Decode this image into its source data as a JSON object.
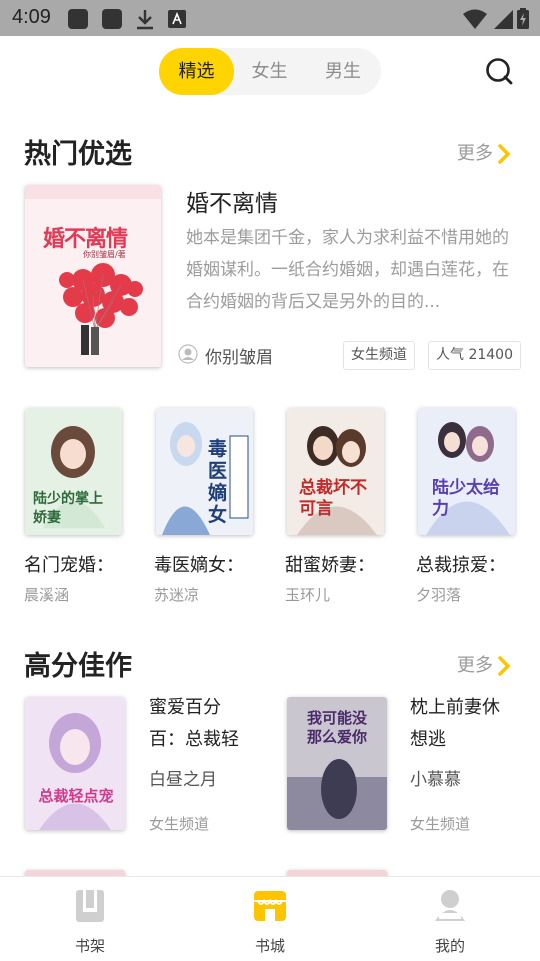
{
  "status_bar": {
    "time": "4:09"
  },
  "tabs": [
    {
      "label": "精选",
      "active": true
    },
    {
      "label": "女生",
      "active": false
    },
    {
      "label": "男生",
      "active": false
    }
  ],
  "hot": {
    "title": "热门优选",
    "more": "更多",
    "featured": {
      "title": "婚不离情",
      "description": "她本是集团千金，家人为求利益不惜用她的婚姻谋利。一纸合约婚姻，却遇白莲花，在合约婚姻的背后又是另外的目的...",
      "author": "你别皱眉",
      "channel": "女生频道",
      "popularity": "人气 21400",
      "cover_text": "婚不离情",
      "cover_sub": "你别皱眉/著"
    },
    "grid": [
      {
        "title": "名门宠婚：",
        "author": "晨溪涵",
        "cover_text": "陆少的掌上娇妻"
      },
      {
        "title": "毒医嫡女：",
        "author": "苏迷凉",
        "cover_text": "毒医嫡女"
      },
      {
        "title": "甜蜜娇妻：",
        "author": "玉环儿",
        "cover_text": "总裁坏不可言"
      },
      {
        "title": "总裁掠爱：",
        "author": "夕羽落",
        "cover_text": "陆少太给力"
      }
    ]
  },
  "high_score": {
    "title": "高分佳作",
    "more": "更多",
    "items": [
      {
        "title": "蜜爱百分百：总裁轻",
        "author": "白昼之月",
        "channel": "女生频道",
        "cover_text": "总裁轻点宠"
      },
      {
        "title": "枕上前妻休想逃",
        "author": "小慕慕",
        "channel": "女生频道",
        "cover_text": "我可能没那么爱你"
      }
    ]
  },
  "bottom_nav": [
    {
      "label": "书架",
      "active": false,
      "icon": "bookshelf-icon"
    },
    {
      "label": "书城",
      "active": true,
      "icon": "bookstore-icon"
    },
    {
      "label": "我的",
      "active": false,
      "icon": "profile-icon"
    }
  ],
  "colors": {
    "accent": "#ffd400",
    "status_bar": "#a9a9a9",
    "muted_text": "#9a9a9a"
  }
}
